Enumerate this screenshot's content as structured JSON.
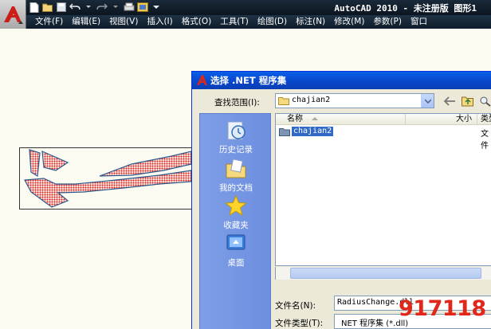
{
  "app": {
    "title": "AutoCAD 2010 - 未注册版   图形1",
    "logo_icon": "autocad-logo-icon"
  },
  "quick_access": [
    "new-icon",
    "open-icon",
    "save-icon",
    "undo-icon",
    "redo-icon",
    "plot-icon",
    "workspace-icon",
    "dropdown-icon"
  ],
  "menu": [
    "文件(F)",
    "编辑(E)",
    "视图(V)",
    "插入(I)",
    "格式(O)",
    "工具(T)",
    "绘图(D)",
    "标注(N)",
    "修改(M)",
    "参数(P)",
    "窗口"
  ],
  "dialog": {
    "title": "选择 .NET 程序集",
    "look_in_label": "查找范围(I):",
    "look_in_value": "chajian2",
    "columns": [
      "名称",
      "大小",
      "类型"
    ],
    "files": [
      {
        "name": "chajian2",
        "type": "文件"
      }
    ],
    "places": [
      "历史记录",
      "我的文档",
      "收藏夹",
      "桌面"
    ],
    "filename_label": "文件名(N):",
    "filename_value": "RadiusChange.dll",
    "filetype_label": "文件类型(T):",
    "filetype_value": "NET 程序集 (*.dll)"
  },
  "watermark": "917118",
  "colors": {
    "titlebar": "#0b1520",
    "dialog_title": "#0846c8",
    "places_bar": "#7e9ee6",
    "selection": "#316ac5",
    "hatch": "#e02020",
    "watermark": "#e2261a"
  }
}
